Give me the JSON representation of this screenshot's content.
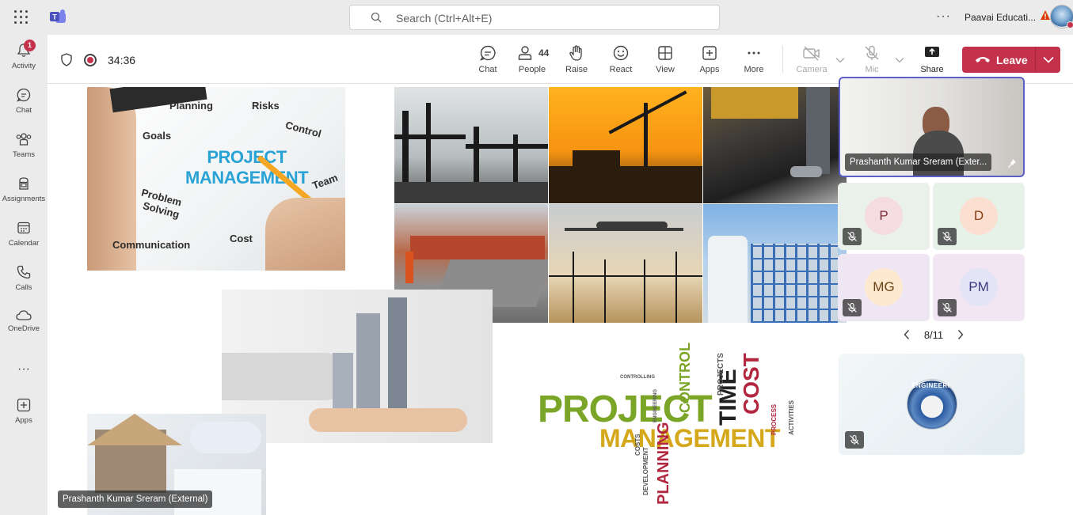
{
  "search": {
    "placeholder": "Search (Ctrl+Alt+E)"
  },
  "top": {
    "more": "···",
    "org": "Paavai Educati..."
  },
  "rail": {
    "items": [
      {
        "label": "Activity",
        "badge": "1"
      },
      {
        "label": "Chat"
      },
      {
        "label": "Teams"
      },
      {
        "label": "Assignments"
      },
      {
        "label": "Calendar"
      },
      {
        "label": "Calls"
      },
      {
        "label": "OneDrive"
      },
      {
        "label": "···"
      },
      {
        "label": "Apps"
      }
    ]
  },
  "meeting": {
    "timer": "34:36",
    "controls": {
      "chat": "Chat",
      "people": "People",
      "people_count": "44",
      "raise": "Raise",
      "react": "React",
      "view": "View",
      "apps": "Apps",
      "more": "More",
      "camera": "Camera",
      "mic": "Mic",
      "share": "Share",
      "leave": "Leave"
    }
  },
  "shared": {
    "presenter": "Prashanth Kumar Sreram (External)",
    "slide": {
      "pm_title_1": "PROJECT",
      "pm_title_2": "MANAGEMENT",
      "pm_words": [
        "Planning",
        "Risks",
        "Goals",
        "Control",
        "Team",
        "Problem",
        "Solving",
        "Communication",
        "Cost"
      ],
      "wordcloud_main": "PROJECT",
      "wordcloud_sub": "MANAGEMENT",
      "wordcloud_time": "TIME",
      "wordcloud_cost": "COST",
      "wordcloud_control": "CONTROL",
      "wordcloud_planning": "PLANNING",
      "wordcloud_projects": "PROJECTS",
      "wordcloud_process": "PROCESS",
      "wordcloud_development": "DEVELOPMENT",
      "wordcloud_costs": "COSTS",
      "wordcloud_activities": "ACTIVITIES",
      "wordcloud_controlling": "CONTROLLING",
      "wordcloud_engineering": "ENGINEERING"
    }
  },
  "roster": {
    "main_tile_name": "Prashanth Kumar Sreram (Exter...",
    "participants": [
      {
        "initials": "P",
        "bg": "#f4dce0",
        "color": "#7a2d3a",
        "tile": "#eaf0ea"
      },
      {
        "initials": "D",
        "bg": "#fbe0d1",
        "color": "#8a3b15",
        "tile": "#e6f1e8"
      },
      {
        "initials": "MG",
        "bg": "#fde8d0",
        "color": "#6b4415",
        "tile": "#efe6f4"
      },
      {
        "initials": "PM",
        "bg": "#e3e4f6",
        "color": "#3b3d7a",
        "tile": "#f1e6f1"
      }
    ],
    "page": "8/11",
    "own_tile_logo": "ENGINEERI"
  },
  "colors": {
    "accent": "#5b5fc7",
    "leave": "#c4314b",
    "badge": "#c4314b"
  }
}
